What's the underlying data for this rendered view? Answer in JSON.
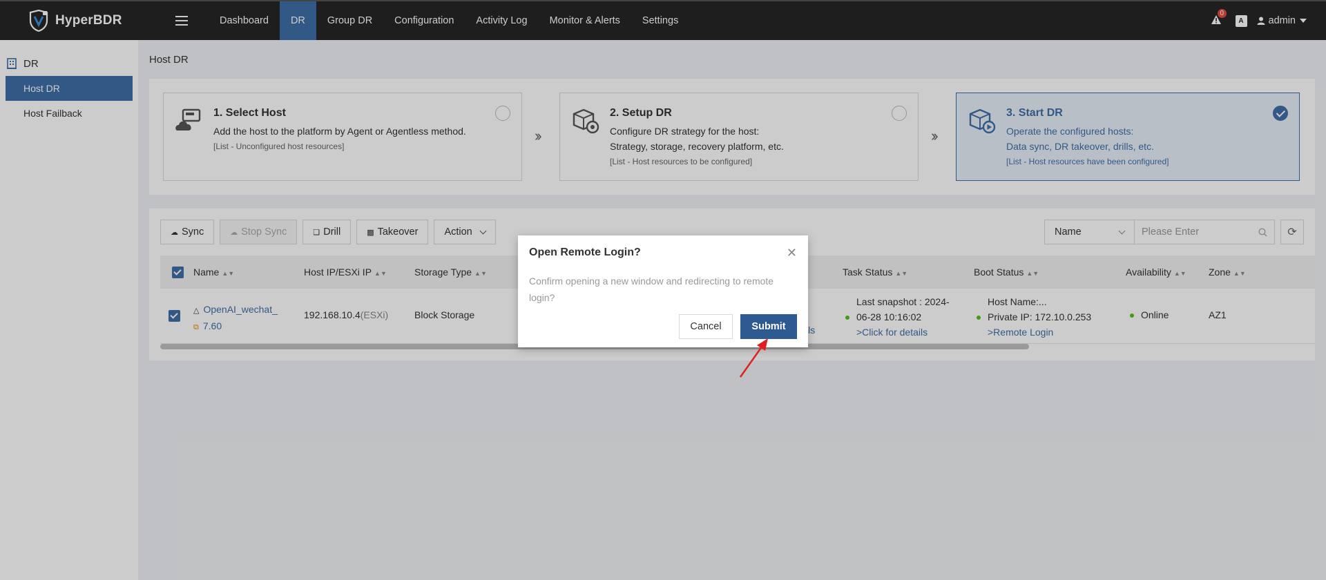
{
  "app": {
    "name": "HyperBDR"
  },
  "nav": {
    "items": [
      "Dashboard",
      "DR",
      "Group DR",
      "Configuration",
      "Activity Log",
      "Monitor & Alerts",
      "Settings"
    ],
    "active_index": 1
  },
  "topbar": {
    "alert_count": "0",
    "lang_icon_label": "A",
    "user": "admin"
  },
  "sidebar": {
    "section": "DR",
    "items": [
      "Host DR",
      "Host Failback"
    ]
  },
  "breadcrumb": "Host DR",
  "steps": [
    {
      "title": "1. Select Host",
      "desc1": "Add the host to the platform by Agent or Agentless method.",
      "desc2": "",
      "note": "[List - Unconfigured host resources]",
      "checked": false
    },
    {
      "title": "2. Setup DR",
      "desc1": "Configure DR strategy for the host:",
      "desc2": "Strategy, storage, recovery platform, etc.",
      "note": "[List - Host resources to be configured]",
      "checked": false
    },
    {
      "title": "3. Start DR",
      "desc1": "Operate the configured hosts:",
      "desc2": "Data sync, DR takeover, drills, etc.",
      "note": "[List - Host resources have been configured]",
      "checked": true
    }
  ],
  "toolbar": {
    "sync": "Sync",
    "stop_sync": "Stop Sync",
    "drill": "Drill",
    "takeover": "Takeover",
    "action": "Action"
  },
  "search": {
    "field": "Name",
    "placeholder": "Please Enter"
  },
  "table": {
    "headers": {
      "name": "Name",
      "host_ip": "Host IP/ESXi IP",
      "storage": "Storage Type",
      "task": "Task Status",
      "boot": "Boot Status",
      "availability": "Availability",
      "zone": "Zone"
    },
    "row": {
      "name_line1": "OpenAI_wechat_",
      "name_line2": "7.60",
      "ip": "192.168.10.4",
      "ip_suffix": "(ESXi)",
      "storage": "Block Storage",
      "hidden_link_tail": "ils",
      "task_line1": "Last snapshot : 2024-",
      "task_line2": "06-28 10:16:02",
      "task_link": ">Click for details",
      "boot_line1": "Host Name:...",
      "boot_line2": "Private IP: 172.10.0.253",
      "boot_link": ">Remote Login",
      "availability": "Online",
      "zone": "AZ1"
    }
  },
  "dialog": {
    "title": "Open Remote Login?",
    "body": "Confirm opening a new window and redirecting to remote login?",
    "cancel": "Cancel",
    "submit": "Submit"
  },
  "colors": {
    "primary": "#3f6fa8",
    "topbar": "#262626",
    "online": "#52c41a",
    "arrow": "#e02020"
  }
}
